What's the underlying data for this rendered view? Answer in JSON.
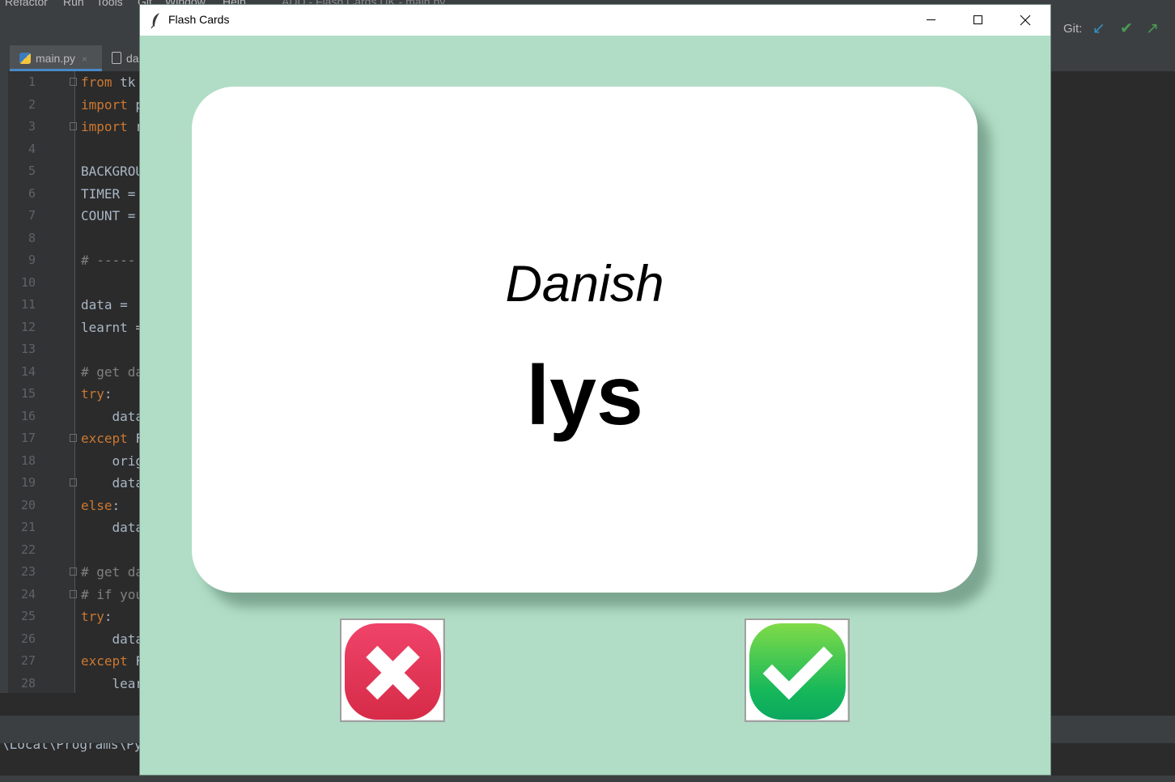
{
  "ide": {
    "menu": [
      "Refactor",
      "Run",
      "Tools",
      "Git",
      "Window",
      "Help"
    ],
    "window_title": "ADD - Flash Cards UK - main.py",
    "tabs": [
      {
        "label": "main.py",
        "close": "×"
      },
      {
        "label": "da"
      }
    ],
    "git_label": "Git:",
    "code_lines": [
      {
        "num": "1",
        "kw": "from",
        "rest": " tk"
      },
      {
        "num": "2",
        "kw": "import",
        "rest": " p"
      },
      {
        "num": "3",
        "kw": "import",
        "rest": " r"
      },
      {
        "num": "4",
        "kw": "",
        "rest": ""
      },
      {
        "num": "5",
        "kw": "",
        "rest": "BACKGROU"
      },
      {
        "num": "6",
        "kw": "",
        "rest": "TIMER ="
      },
      {
        "num": "7",
        "kw": "",
        "rest": "COUNT ="
      },
      {
        "num": "8",
        "kw": "",
        "rest": ""
      },
      {
        "num": "9",
        "kw": "",
        "rest": "",
        "comment": "# -----"
      },
      {
        "num": "10",
        "kw": "",
        "rest": ""
      },
      {
        "num": "11",
        "kw": "",
        "rest": "data ="
      },
      {
        "num": "12",
        "kw": "",
        "rest": "learnt ="
      },
      {
        "num": "13",
        "kw": "",
        "rest": ""
      },
      {
        "num": "14",
        "kw": "",
        "rest": "",
        "comment": "# get da"
      },
      {
        "num": "15",
        "kw": "try",
        "rest": ":"
      },
      {
        "num": "16",
        "kw": "",
        "rest": "    data"
      },
      {
        "num": "17",
        "kw": "except",
        "rest": " F"
      },
      {
        "num": "18",
        "kw": "",
        "rest": "    orig"
      },
      {
        "num": "19",
        "kw": "",
        "rest": "    data"
      },
      {
        "num": "20",
        "kw": "else",
        "rest": ":"
      },
      {
        "num": "21",
        "kw": "",
        "rest": "    data"
      },
      {
        "num": "22",
        "kw": "",
        "rest": ""
      },
      {
        "num": "23",
        "kw": "",
        "rest": "",
        "comment": "# get da"
      },
      {
        "num": "24",
        "kw": "",
        "rest": "",
        "comment": "# if you"
      },
      {
        "num": "25",
        "kw": "try",
        "rest": ":"
      },
      {
        "num": "26",
        "kw": "",
        "rest": "    data"
      },
      {
        "num": "27",
        "kw": "except",
        "rest": " F"
      },
      {
        "num": "28",
        "kw": "",
        "rest": "    lear"
      }
    ],
    "console_text": "\\Local\\Programs\\Py"
  },
  "app": {
    "title": "Flash Cards",
    "card": {
      "language": "Danish",
      "word": "lys"
    },
    "colors": {
      "background": "#b1ddc6",
      "card": "#ffffff",
      "wrong": "#e23a58",
      "right": "#36c65a"
    }
  }
}
